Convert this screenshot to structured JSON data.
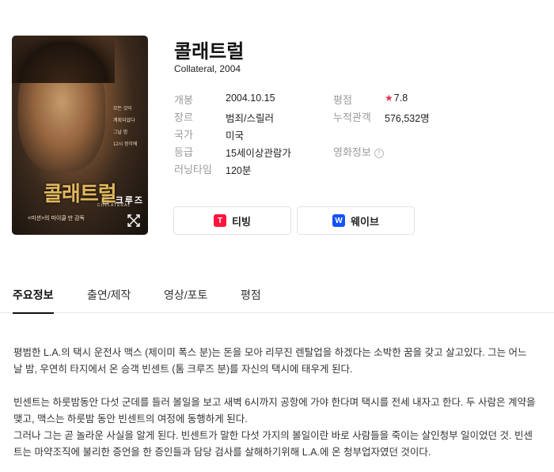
{
  "movie": {
    "title": "콜래트럴",
    "subtitle": "Collateral, 2004"
  },
  "poster": {
    "star_name": "톰 크루즈",
    "title": "콜래트럴",
    "title_en": "COLLATERAL",
    "tagline": "<미션>의 마이클 만 감독",
    "side_lines": [
      "모든 것이",
      "계획되었다",
      "그날 밤",
      "12시 정각에"
    ]
  },
  "info": {
    "left": [
      {
        "label": "개봉",
        "value": "2004.10.15"
      },
      {
        "label": "장르",
        "value": "범죄/스릴러"
      },
      {
        "label": "국가",
        "value": "미국"
      },
      {
        "label": "등급",
        "value": "15세이상관람가"
      },
      {
        "label": "러닝타임",
        "value": "120분"
      }
    ],
    "right": [
      {
        "label": "평점",
        "value": "7.8"
      },
      {
        "label": "누적관객",
        "value": "576,532명"
      },
      {
        "label": "영화정보",
        "value": ""
      }
    ]
  },
  "ott": [
    {
      "name": "티빙",
      "logo_letter": "T",
      "color": "#ff153c"
    },
    {
      "name": "웨이브",
      "logo_letter": "W",
      "color": "#1351f9"
    }
  ],
  "tabs": [
    {
      "label": "주요정보",
      "active": true
    },
    {
      "label": "출연/제작",
      "active": false
    },
    {
      "label": "영상/포토",
      "active": false
    },
    {
      "label": "평점",
      "active": false
    }
  ],
  "synopsis": {
    "paragraph1": "평범한 L.A.의 택시 운전사 맥스 (제이미 폭스 분)는 돈을 모아 리무진 렌탈업을 하겠다는 소박한 꿈을 갖고 살고있다. 그는 어느날 밤, 우연히 타지에서 온 승객 빈센트 (톰 크루즈 분)를 자신의 택시에 태우게 된다.",
    "paragraph2": "빈센트는 하룻밤동안 다섯 군데를 들러 볼일을 보고 새벽 6시까지 공항에 가야 한다며 택시를 전세 내자고 한다. 두 사람은 계약을 맺고, 맥스는 하룻밤 동안 빈센트의 여정에 동행하게 된다.",
    "paragraph3": "그러나 그는 곧 놀라운 사실을 알게 된다. 빈센트가 말한 다섯 가지의 볼일이란 바로 사람들을 죽이는 살인청부 일이었던 것. 빈센트는 마약조직에 불리한 증언을 한 증인들과 담당 검사를 살해하기위해 L.A.에 온 청부업자였던 것이다."
  },
  "colors": {
    "rating_star": "#e4314b",
    "tving": "#ff153c",
    "wavve": "#1351f9"
  }
}
